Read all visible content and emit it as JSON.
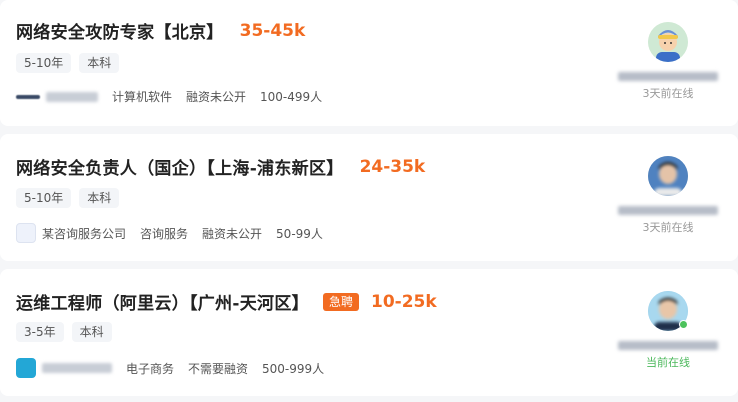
{
  "jobs": [
    {
      "title": "网络安全攻防专家【北京】",
      "salary": "35-45k",
      "tags": [
        "5-10年",
        "本科"
      ],
      "company": {
        "name": "",
        "industry": "计算机软件",
        "funding": "融资未公开",
        "size": "100-499人"
      },
      "recruiter": {
        "status": "3天前在线"
      }
    },
    {
      "title": "网络安全负责人（国企）【上海-浦东新区】",
      "salary": "24-35k",
      "tags": [
        "5-10年",
        "本科"
      ],
      "company": {
        "name": "某咨询服务公司",
        "industry": "咨询服务",
        "funding": "融资未公开",
        "size": "50-99人"
      },
      "recruiter": {
        "status": "3天前在线"
      }
    },
    {
      "title": "运维工程师（阿里云）【广州-天河区】",
      "urgent": "急聘",
      "salary": "10-25k",
      "tags": [
        "3-5年",
        "本科"
      ],
      "company": {
        "name": "",
        "industry": "电子商务",
        "funding": "不需要融资",
        "size": "500-999人"
      },
      "recruiter": {
        "status": "当前在线"
      }
    }
  ],
  "colors": {
    "salary": "#f26b21",
    "online": "#4cb85c",
    "tag_bg": "#f3f5f8"
  }
}
